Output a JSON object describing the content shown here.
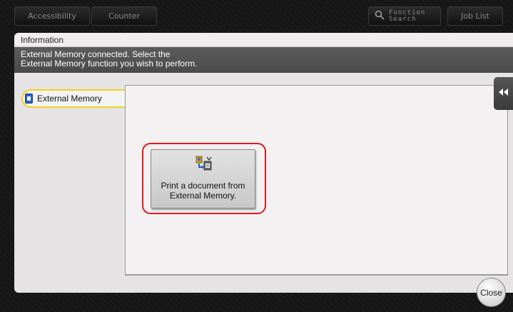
{
  "topbar": {
    "accessibility_label": "Accessibility",
    "counter_label": "Counter",
    "function_search_label": "Function\nSearch",
    "job_list_label": "Job List"
  },
  "panel": {
    "header_title": "Information",
    "message_line1": "External Memory connected. Select the",
    "message_line2": "External Memory function you wish to perform."
  },
  "sidebar": {
    "tab_label": "External Memory"
  },
  "actions": {
    "print_label": "Print a document from External Memory."
  },
  "footer": {
    "close_label": "Close"
  },
  "colors": {
    "highlight": "#e0191f",
    "tab_outline": "#f1d21a"
  },
  "icons": {
    "search": "search-icon",
    "memory": "usb-memory-icon",
    "print_from_memory": "print-from-memory-icon",
    "collapse": "double-chevron-left-icon"
  }
}
